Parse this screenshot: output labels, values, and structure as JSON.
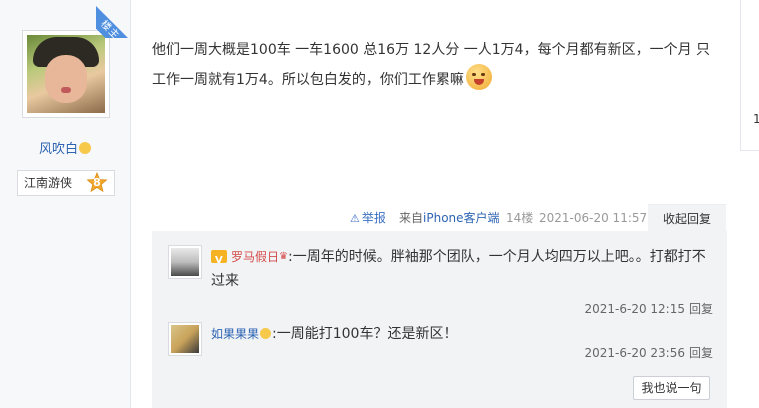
{
  "author": {
    "name": "风吹白",
    "badge_label": "楼主",
    "honor_title": "江南游侠",
    "honor_level": "8"
  },
  "post": {
    "text": "他们一周大概是100车 一车1600 总16万 12人分 一人1万4，每个月都有新区，一个月 只工作一周就有1万4。所以包白发的，你们工作累嘛"
  },
  "meta": {
    "report_label": "举报",
    "from_prefix": "来自",
    "device": "iPhone客户端",
    "floor": "14楼",
    "time": "2021-06-20 11:57",
    "collapse_label": "收起回复"
  },
  "replies": [
    {
      "user": "罗马假日",
      "text": ":一周年的时候。胖袖那个团队，一个月人均四万以上吧。。打都打不过来",
      "time": "2021-6-20 12:15",
      "reply_label": "回复"
    },
    {
      "user": "如果果果",
      "text": ":一周能打100车？还是新区！",
      "time": "2021-6-20 23:56",
      "reply_label": "回复"
    }
  ],
  "me_too_label": "我也说一句",
  "side_stub_text": "1",
  "colors": {
    "link_blue": "#2d64b3",
    "badge_blue": "#4f8fe0",
    "reply_bg": "#f2f3f5",
    "vip_name_red": "#d44a4a"
  }
}
